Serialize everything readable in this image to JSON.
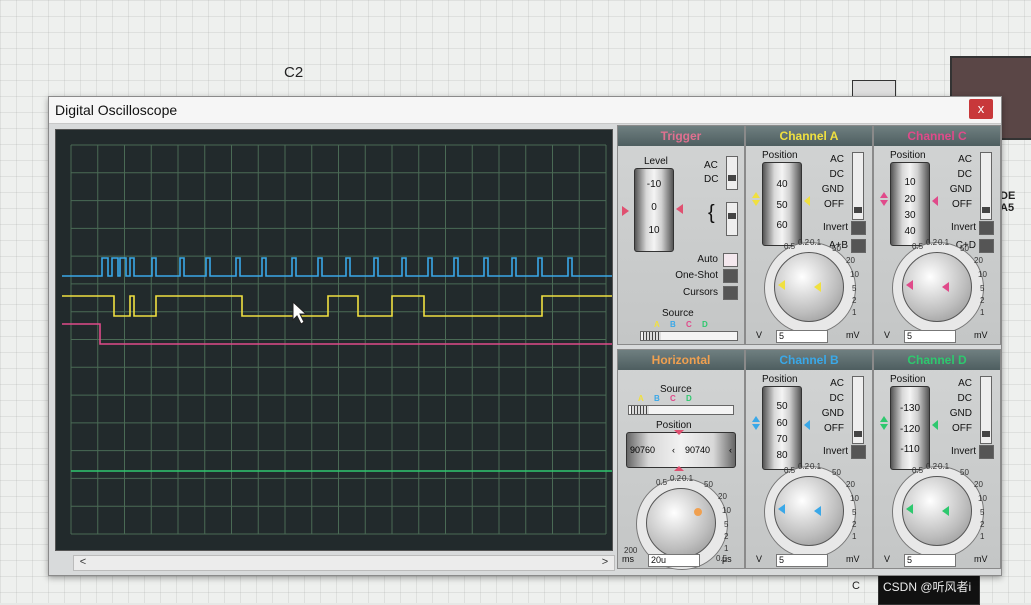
{
  "background": {
    "c2_label": "C2",
    "c_label": "C",
    "pins_label": "DE A5",
    "watermark": "CSDN @听风者i"
  },
  "window": {
    "title": "Digital Oscilloscope",
    "close_label": "x"
  },
  "scroll": {
    "left": "<",
    "right": ">"
  },
  "colors": {
    "channel_a": "#f0e040",
    "channel_b": "#3aa8e8",
    "channel_c": "#e04a8a",
    "channel_d": "#2ec86e",
    "trigger": "#e07090",
    "horizontal": "#f0a050",
    "screen_bg": "#222a2c",
    "grid": "#4a6a55"
  },
  "trigger": {
    "title": "Trigger",
    "level_label": "Level",
    "level_ticks": [
      "-10",
      "0",
      "10"
    ],
    "ac": "AC",
    "dc": "DC",
    "auto": "Auto",
    "one_shot": "One-Shot",
    "cursors": "Cursors",
    "source_label": "Source",
    "sources": [
      "A",
      "B",
      "C",
      "D"
    ]
  },
  "horizontal": {
    "title": "Horizontal",
    "source_label": "Source",
    "sources": [
      "A",
      "B",
      "C",
      "D"
    ],
    "position_label": "Position",
    "pos_left": "90760",
    "pos_right": "90740",
    "scale": [
      "0.5",
      "0.2",
      "0.1",
      "50",
      "20",
      "10",
      "5",
      "2",
      "1",
      "0.5",
      "0.2"
    ],
    "unit_left": "ms",
    "unit_right": "μs",
    "unit_min": "200",
    "timebase": "20u"
  },
  "channels": [
    {
      "key": "a",
      "title": "Channel A",
      "position_label": "Position",
      "ticks": [
        "40",
        "50",
        "60"
      ],
      "ac": "AC",
      "dc": "DC",
      "gnd": "GND",
      "off": "OFF",
      "invert": "Invert",
      "combine": "A+B",
      "scale": [
        "0.5",
        "0.2",
        "0.1",
        "50",
        "20",
        "10",
        "5",
        "2",
        "1"
      ],
      "unit_left": "V",
      "unit_right": "mV",
      "volts_div": "5"
    },
    {
      "key": "b",
      "title": "Channel B",
      "position_label": "Position",
      "ticks": [
        "50",
        "60",
        "70",
        "80"
      ],
      "ac": "AC",
      "dc": "DC",
      "gnd": "GND",
      "off": "OFF",
      "invert": "Invert",
      "combine": "",
      "scale": [
        "0.5",
        "0.2",
        "0.1",
        "50",
        "20",
        "10",
        "5",
        "2",
        "1"
      ],
      "unit_left": "V",
      "unit_right": "mV",
      "volts_div": "5"
    },
    {
      "key": "c",
      "title": "Channel C",
      "position_label": "Position",
      "ticks": [
        "10",
        "20",
        "30",
        "40"
      ],
      "ac": "AC",
      "dc": "DC",
      "gnd": "GND",
      "off": "OFF",
      "invert": "Invert",
      "combine": "C+D",
      "scale": [
        "0.5",
        "0.2",
        "0.1",
        "50",
        "20",
        "10",
        "5",
        "2",
        "1"
      ],
      "unit_left": "V",
      "unit_right": "mV",
      "volts_div": "5"
    },
    {
      "key": "d",
      "title": "Channel D",
      "position_label": "Position",
      "ticks": [
        "-130",
        "-120",
        "-110"
      ],
      "ac": "AC",
      "dc": "DC",
      "gnd": "GND",
      "off": "OFF",
      "invert": "Invert",
      "combine": "",
      "scale": [
        "0.5",
        "0.2",
        "0.1",
        "50",
        "20",
        "10",
        "5",
        "2",
        "1"
      ],
      "unit_left": "V",
      "unit_right": "mV",
      "volts_div": "5"
    }
  ]
}
